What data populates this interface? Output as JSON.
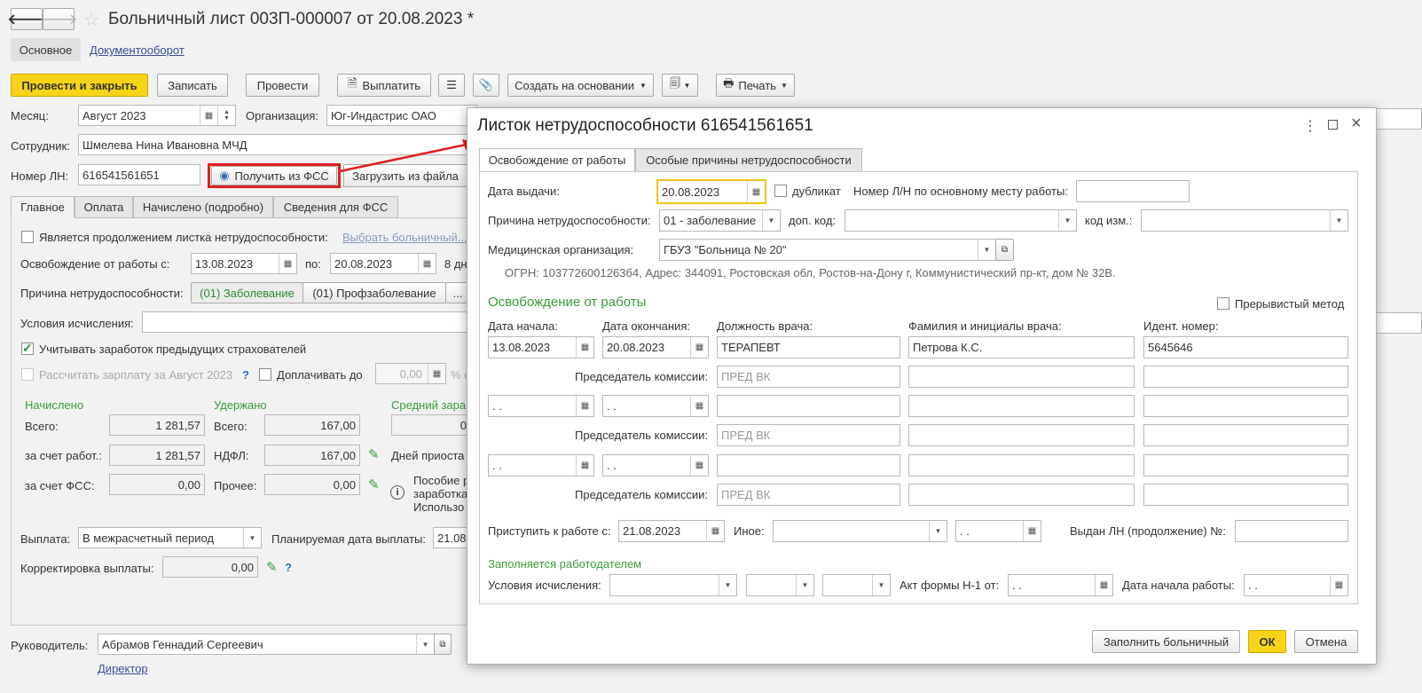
{
  "window": {
    "title": "Больничный лист 003П-000007 от 20.08.2023 *"
  },
  "nav_tabs": [
    {
      "label": "Основное"
    },
    {
      "label": "Документооборот"
    }
  ],
  "toolbar": {
    "post_close": "Провести и закрыть",
    "save": "Записать",
    "post": "Провести",
    "pay": "Выплатить",
    "create_based": "Создать на основании",
    "print": "Печать"
  },
  "header": {
    "month_label": "Месяц:",
    "month_value": "Август 2023",
    "org_label": "Организация:",
    "org_value": "Юг-Индастрис ОАО",
    "employee_label": "Сотрудник:",
    "employee_value": "Шмелева Нина Ивановна МЧД",
    "ln_label": "Номер ЛН:",
    "ln_value": "616541561651",
    "get_fss": "Получить из ФСС",
    "load_file": "Загрузить из файла"
  },
  "main_tabs": [
    {
      "label": "Главное"
    },
    {
      "label": "Оплата"
    },
    {
      "label": "Начислено (подробно)"
    },
    {
      "label": "Сведения для ФСС"
    }
  ],
  "main": {
    "continuation_label": "Является продолжением листка нетрудоспособности:",
    "choose_sick": "Выбрать больничный...",
    "release_from_label": "Освобождение от работы с:",
    "release_from": "13.08.2023",
    "to_label": "по:",
    "release_to": "20.08.2023",
    "days": "8 дн",
    "reason_label": "Причина нетрудоспособности:",
    "reason_sick": "(01) Заболевание",
    "reason_prof": "(01) Профзаболевание",
    "reason_more": "...",
    "calc_cond_label": "Условия исчисления:",
    "prev_insurers": "Учитывать заработок предыдущих страхователей",
    "calc_salary": "Рассчитать зарплату за Август 2023",
    "help": "?",
    "pay_up_to": "Доплачивать до",
    "pay_up_value": "0,00",
    "percent": "% с",
    "accrued_head": "Начислено",
    "withheld_head": "Удержано",
    "avg_head": "Средний зара",
    "total_label": "Всего:",
    "accrued_total": "1 281,57",
    "withheld_total_label": "Всего:",
    "withheld_total": "167,00",
    "avg_value": "0",
    "employer_label": "за счет работ.:",
    "employer_value": "1 281,57",
    "ndfl_label": "НДФЛ:",
    "ndfl_value": "167,00",
    "idle_days": "Дней приоста",
    "fss_label": "за счет ФСС:",
    "fss_value": "0,00",
    "other_label": "Прочее:",
    "other_value": "0,00",
    "info_line1": "Пособие р",
    "info_line2": "заработка",
    "info_line3": "Использо",
    "payout_label": "Выплата:",
    "payout_value": "В межрасчетный период",
    "planned_label": "Планируемая дата выплаты:",
    "planned_value": "21.08",
    "correction_label": "Корректировка выплаты:",
    "correction_value": "0,00"
  },
  "footer": {
    "manager_label": "Руководитель:",
    "manager_value": "Абрамов Геннадий Сергеевич",
    "position": "Директор"
  },
  "dialog": {
    "title": "Листок нетрудоспособности 616541561651",
    "tabs": [
      {
        "label": "Освобождение от работы"
      },
      {
        "label": "Особые причины нетрудоспособности"
      }
    ],
    "issue_label": "Дата выдачи:",
    "issue_date": "20.08.2023",
    "duplicate": "дубликат",
    "main_ln_label": "Номер Л/Н по основному месту работы:",
    "reason_label": "Причина нетрудоспособности:",
    "reason_value": "01 - заболевание",
    "add_code_label": "доп. код:",
    "change_code_label": "код изм.:",
    "med_org_label": "Медицинская организация:",
    "med_org_value": "ГБУЗ \"Больница № 20\"",
    "ogrn": "ОГРН: 1037726001263б4, Адрес: 344091, Ростовская обл, Ростов-на-Дону г, Коммунистический пр-кт, дом № 32В.",
    "release_head": "Освобождение от работы",
    "intermittent": "Прерывистый метод",
    "col_start": "Дата начала:",
    "col_end": "Дата окончания:",
    "col_position": "Должность врача:",
    "col_name": "Фамилия и инициалы врача:",
    "col_id": "Идент.  номер:",
    "row1": {
      "start": "13.08.2023",
      "end": "20.08.2023",
      "position": "ТЕРАПЕВТ",
      "name": "Петрова К.С.",
      "id": "5645646"
    },
    "chairman_label": "Председатель комиссии:",
    "chairman_ph": "ПРЕД ВК",
    "empty_date": " .  .",
    "return_label": "Приступить к работе с:",
    "return_value": "21.08.2023",
    "other_label": "Иное:",
    "issued_cont_label": "Выдан ЛН (продолжение) №:",
    "employer_head": "Заполняется работодателем",
    "calc_cond_label": "Условия исчисления:",
    "act_label": "Акт формы Н-1 от:",
    "work_start_label": "Дата начала работы:",
    "fill_btn": "Заполнить больничный",
    "ok_btn": "ОК",
    "cancel_btn": "Отмена"
  },
  "colors": {
    "accent": "#f7d417",
    "highlight": "#e02020",
    "green": "#3a9a3a",
    "link": "#3a4f9a"
  }
}
